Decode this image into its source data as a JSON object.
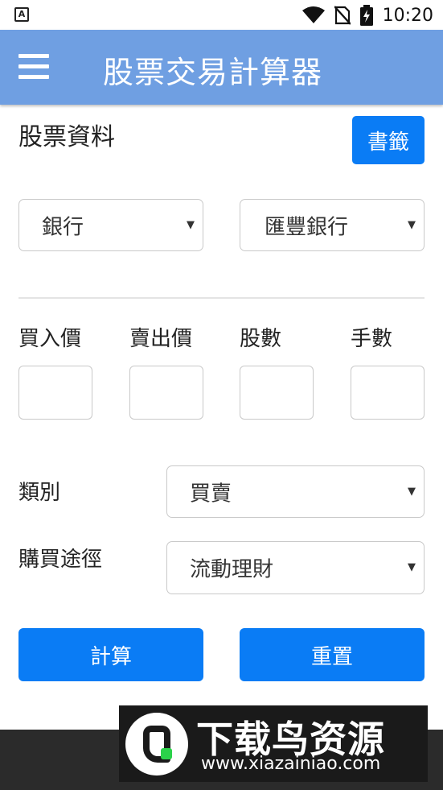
{
  "status_bar": {
    "notification_icon": "accessibility-a-icon",
    "icons": [
      "wifi-icon",
      "no-sim-icon",
      "battery-charging-icon"
    ],
    "time": "10:20"
  },
  "app_bar": {
    "menu_icon": "hamburger-menu-icon",
    "title": "股票交易計算器"
  },
  "stock_info": {
    "title": "股票資料",
    "bookmark_label": "書籤",
    "category_select": "銀行",
    "stock_select": "匯豐銀行"
  },
  "columns": {
    "buy_price": "買入價",
    "sell_price": "賣出價",
    "shares": "股數",
    "lots": "手數",
    "buy_price_value": "",
    "sell_price_value": "",
    "shares_value": "",
    "lots_value": ""
  },
  "type_row": {
    "label": "類別",
    "value": "買賣"
  },
  "channel_row": {
    "label": "購買途徑",
    "value": "流動理財"
  },
  "actions": {
    "calculate_label": "計算",
    "reset_label": "重置"
  },
  "watermark": {
    "text": "下载鸟资源",
    "url": "www.xiazainiao.com"
  },
  "colors": {
    "app_bar": "#6f9fe2",
    "primary_button": "#0a7cf5",
    "watermark_bg": "#1a1a1a"
  }
}
